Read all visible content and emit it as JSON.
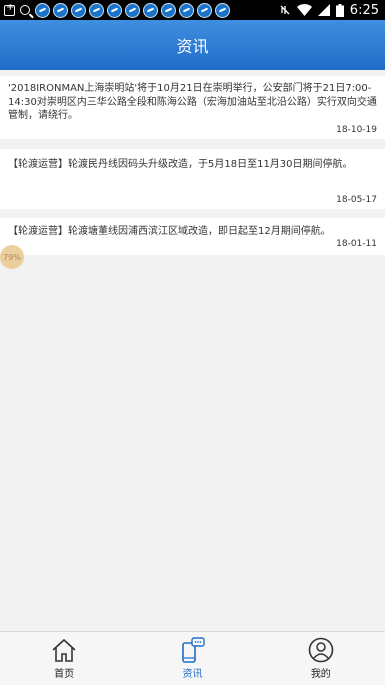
{
  "status_bar": {
    "time": "6:25",
    "notification_icons": [
      "add-box-icon",
      "search-icon",
      "app-icon",
      "app-icon",
      "app-icon",
      "app-icon",
      "app-icon",
      "app-icon",
      "app-icon",
      "app-icon",
      "app-icon",
      "app-icon",
      "app-icon"
    ]
  },
  "header": {
    "title": "资讯"
  },
  "news": [
    {
      "text": "'2018IRONMAN上海崇明站'将于10月21日在崇明举行，公安部门将于21日7:00-14:30对崇明区内三华公路全段和陈海公路（宏海加油站至北沿公路）实行双向交通管制，请绕行。",
      "date": "18-10-19"
    },
    {
      "text": "【轮渡运营】轮渡民丹线因码头升级改造，于5月18日至11月30日期间停航。",
      "date": "18-05-17"
    },
    {
      "text": "【轮渡运营】轮渡塘董线因浦西滨江区域改造，即日起至12月期间停航。",
      "date": "18-01-11"
    }
  ],
  "float_badge": {
    "text": "79%"
  },
  "bottom_nav": {
    "items": [
      {
        "label": "首页",
        "icon": "home-icon"
      },
      {
        "label": "资讯",
        "icon": "phone-chat-icon",
        "active": true
      },
      {
        "label": "我的",
        "icon": "user-icon"
      }
    ]
  },
  "colors": {
    "header": "#1f6cc7",
    "active_nav": "#1f6cc7"
  }
}
